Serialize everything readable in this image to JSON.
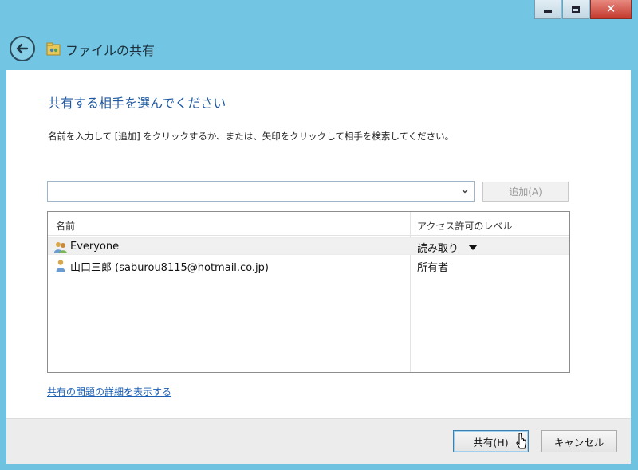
{
  "window": {
    "title": "ファイルの共有",
    "controls": {
      "minimize": "minimize",
      "maximize": "maximize",
      "close": "✕"
    }
  },
  "main": {
    "heading": "共有する相手を選んでください",
    "instructions": "名前を入力して [追加] をクリックするか、または、矢印をクリックして相手を検索してください。",
    "name_input": {
      "value": "",
      "placeholder": ""
    },
    "add_button": "追加(A)",
    "table": {
      "columns": [
        "名前",
        "アクセス許可のレベル"
      ],
      "rows": [
        {
          "name": "Everyone",
          "permission": "読み取り",
          "icon": "group-users-icon",
          "has_dropdown": true
        },
        {
          "name": "山口三郎 (saburou8115@hotmail.co.jp)",
          "permission": "所有者",
          "icon": "user-icon",
          "has_dropdown": false
        }
      ]
    },
    "help_link": "共有の問題の詳細を表示する"
  },
  "footer": {
    "share_button": "共有(H)",
    "cancel_button": "キャンセル"
  },
  "colors": {
    "window_chrome": "#73c6e3",
    "heading": "#1f5aa0",
    "link": "#1a5fb4",
    "close_button": "#c4382c"
  }
}
